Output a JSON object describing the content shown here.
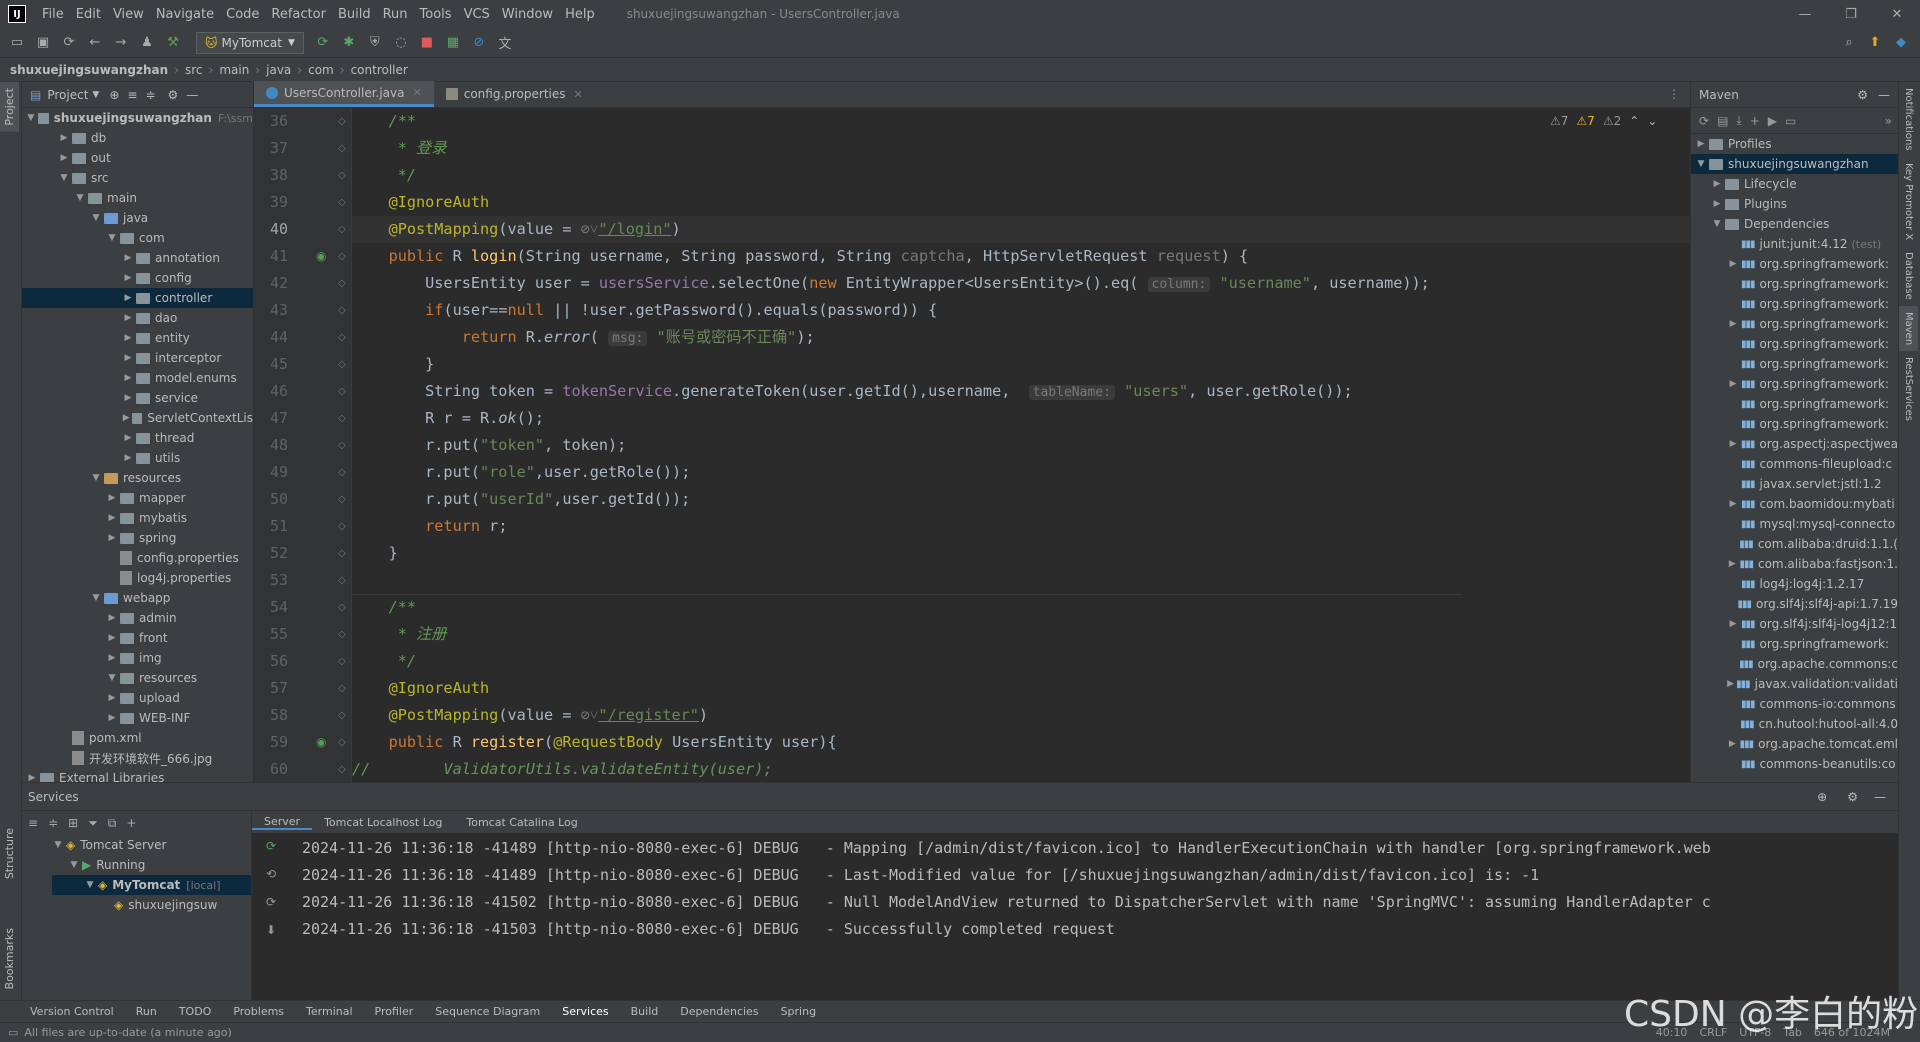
{
  "menubar": {
    "items": [
      "File",
      "Edit",
      "View",
      "Navigate",
      "Code",
      "Refactor",
      "Build",
      "Run",
      "Tools",
      "VCS",
      "Window",
      "Help"
    ],
    "title": "shuxuejingsuwangzhan - UsersController.java"
  },
  "toolbar": {
    "run_config": "MyTomcat"
  },
  "breadcrumb": [
    "shuxuejingsuwangzhan",
    "src",
    "main",
    "java",
    "com",
    "controller"
  ],
  "project_panel": {
    "title": "Project",
    "root": "shuxuejingsuwangzhan",
    "root_hint": "F:\\ssm",
    "items": [
      {
        "label": "db",
        "depth": 1,
        "type": "folder"
      },
      {
        "label": "out",
        "depth": 1,
        "type": "folder"
      },
      {
        "label": "src",
        "depth": 1,
        "type": "folder"
      },
      {
        "label": "main",
        "depth": 2,
        "type": "folder"
      },
      {
        "label": "java",
        "depth": 3,
        "type": "folder-blue"
      },
      {
        "label": "com",
        "depth": 4,
        "type": "folder"
      },
      {
        "label": "annotation",
        "depth": 5,
        "type": "folder"
      },
      {
        "label": "config",
        "depth": 5,
        "type": "folder"
      },
      {
        "label": "controller",
        "depth": 5,
        "type": "folder",
        "selected": true
      },
      {
        "label": "dao",
        "depth": 5,
        "type": "folder"
      },
      {
        "label": "entity",
        "depth": 5,
        "type": "folder"
      },
      {
        "label": "interceptor",
        "depth": 5,
        "type": "folder"
      },
      {
        "label": "model.enums",
        "depth": 5,
        "type": "folder"
      },
      {
        "label": "service",
        "depth": 5,
        "type": "folder"
      },
      {
        "label": "ServletContextLis",
        "depth": 5,
        "type": "folder"
      },
      {
        "label": "thread",
        "depth": 5,
        "type": "folder"
      },
      {
        "label": "utils",
        "depth": 5,
        "type": "folder"
      },
      {
        "label": "resources",
        "depth": 3,
        "type": "folder-res"
      },
      {
        "label": "mapper",
        "depth": 4,
        "type": "folder"
      },
      {
        "label": "mybatis",
        "depth": 4,
        "type": "folder"
      },
      {
        "label": "spring",
        "depth": 4,
        "type": "folder"
      },
      {
        "label": "config.properties",
        "depth": 4,
        "type": "file"
      },
      {
        "label": "log4j.properties",
        "depth": 4,
        "type": "file"
      },
      {
        "label": "webapp",
        "depth": 3,
        "type": "folder-blue"
      },
      {
        "label": "admin",
        "depth": 4,
        "type": "folder"
      },
      {
        "label": "front",
        "depth": 4,
        "type": "folder"
      },
      {
        "label": "img",
        "depth": 4,
        "type": "folder"
      },
      {
        "label": "resources",
        "depth": 4,
        "type": "folder"
      },
      {
        "label": "upload",
        "depth": 4,
        "type": "folder"
      },
      {
        "label": "WEB-INF",
        "depth": 4,
        "type": "folder"
      },
      {
        "label": "pom.xml",
        "depth": 1,
        "type": "file"
      },
      {
        "label": "开发环境软件_666.jpg",
        "depth": 1,
        "type": "file"
      },
      {
        "label": "External Libraries",
        "depth": 0,
        "type": "folder"
      }
    ]
  },
  "editor": {
    "tabs": [
      {
        "label": "UsersController.java",
        "active": true
      },
      {
        "label": "config.properties",
        "active": false
      }
    ],
    "inspections": {
      "warn1": "7",
      "warn2": "7",
      "weak": "2"
    },
    "line_numbers": [
      "36",
      "37",
      "38",
      "39",
      "40",
      "41",
      "42",
      "43",
      "44",
      "45",
      "46",
      "47",
      "48",
      "49",
      "50",
      "51",
      "52",
      "53",
      "54",
      "55",
      "56",
      "57",
      "58",
      "59",
      "60"
    ],
    "current_line": "40"
  },
  "maven": {
    "title": "Maven",
    "items": [
      {
        "label": "Profiles",
        "depth": 0
      },
      {
        "label": "shuxuejingsuwangzhan",
        "depth": 0,
        "selected": true
      },
      {
        "label": "Lifecycle",
        "depth": 1
      },
      {
        "label": "Plugins",
        "depth": 1
      },
      {
        "label": "Dependencies",
        "depth": 1
      },
      {
        "label": "junit:junit:4.12",
        "depth": 2,
        "hint": "(test)"
      },
      {
        "label": "org.springframework:",
        "depth": 2
      },
      {
        "label": "org.springframework:",
        "depth": 2
      },
      {
        "label": "org.springframework:",
        "depth": 2
      },
      {
        "label": "org.springframework:",
        "depth": 2
      },
      {
        "label": "org.springframework:",
        "depth": 2
      },
      {
        "label": "org.springframework:",
        "depth": 2
      },
      {
        "label": "org.springframework:",
        "depth": 2
      },
      {
        "label": "org.springframework:",
        "depth": 2
      },
      {
        "label": "org.springframework:",
        "depth": 2
      },
      {
        "label": "org.aspectj:aspectjwea",
        "depth": 2
      },
      {
        "label": "commons-fileupload:c",
        "depth": 2
      },
      {
        "label": "javax.servlet:jstl:1.2",
        "depth": 2
      },
      {
        "label": "com.baomidou:mybati",
        "depth": 2
      },
      {
        "label": "mysql:mysql-connecto",
        "depth": 2
      },
      {
        "label": "com.alibaba:druid:1.1.(",
        "depth": 2
      },
      {
        "label": "com.alibaba:fastjson:1.",
        "depth": 2
      },
      {
        "label": "log4j:log4j:1.2.17",
        "depth": 2
      },
      {
        "label": "org.slf4j:slf4j-api:1.7.19",
        "depth": 2
      },
      {
        "label": "org.slf4j:slf4j-log4j12:1",
        "depth": 2
      },
      {
        "label": "org.springframework:",
        "depth": 2
      },
      {
        "label": "org.apache.commons:c",
        "depth": 2
      },
      {
        "label": "javax.validation:validati",
        "depth": 2
      },
      {
        "label": "commons-io:commons",
        "depth": 2
      },
      {
        "label": "cn.hutool:hutool-all:4.0",
        "depth": 2
      },
      {
        "label": "org.apache.tomcat.eml",
        "depth": 2
      },
      {
        "label": "commons-beanutils:co",
        "depth": 2
      }
    ]
  },
  "services": {
    "title": "Services",
    "tree": [
      {
        "label": "Tomcat Server",
        "depth": 0
      },
      {
        "label": "Running",
        "depth": 1
      },
      {
        "label": "MyTomcat",
        "hint": "[local]",
        "depth": 2,
        "selected": true
      },
      {
        "label": "shuxuejingsuw",
        "depth": 3
      }
    ],
    "subtabs": [
      "Server",
      "Tomcat Localhost Log",
      "Tomcat Catalina Log"
    ],
    "logs": [
      "2024-11-26 11:36:18 -41489 [http-nio-8080-exec-6] DEBUG   - Mapping [/admin/dist/favicon.ico] to HandlerExecutionChain with handler [org.springframework.web",
      "2024-11-26 11:36:18 -41489 [http-nio-8080-exec-6] DEBUG   - Last-Modified value for [/shuxuejingsuwangzhan/admin/dist/favicon.ico] is: -1",
      "2024-11-26 11:36:18 -41502 [http-nio-8080-exec-6] DEBUG   - Null ModelAndView returned to DispatcherServlet with name 'SpringMVC': assuming HandlerAdapter c",
      "2024-11-26 11:36:18 -41503 [http-nio-8080-exec-6] DEBUG   - Successfully completed request"
    ]
  },
  "bottom_tabs": [
    "Version Control",
    "Run",
    "TODO",
    "Problems",
    "Terminal",
    "Profiler",
    "Sequence Diagram",
    "Services",
    "Build",
    "Dependencies",
    "Spring"
  ],
  "active_bottom_tab": "Services",
  "statusbar": {
    "message": "All files are up-to-date (a minute ago)",
    "position": "40:10",
    "line_sep": "CRLF",
    "encoding": "UTF-8",
    "indent": "Tab",
    "memory": "646 of 1024M"
  },
  "left_stripe": [
    "Project",
    "Structure",
    "Bookmarks"
  ],
  "right_stripe": [
    "Notifications",
    "Key Promoter X",
    "Database",
    "Maven",
    "RestServices"
  ],
  "watermark": "CSDN @李白的粉"
}
